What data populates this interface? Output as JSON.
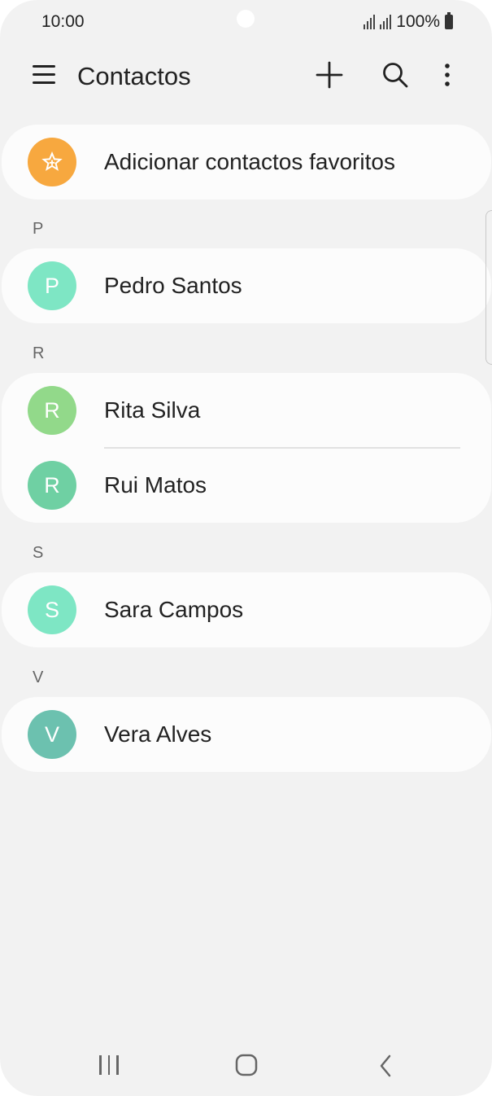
{
  "status_bar": {
    "time": "10:00",
    "battery_text": "100%",
    "icons": [
      "signal-icon",
      "signal-icon",
      "battery-icon"
    ]
  },
  "app_bar": {
    "title": "Contactos",
    "icons": [
      "menu-icon",
      "add-icon",
      "search-icon",
      "more-options-icon"
    ]
  },
  "favorites": {
    "label": "Adicionar contactos favoritos",
    "icon": "star-icon",
    "color": "#F7A83F"
  },
  "sections": [
    {
      "letter": "P",
      "contacts": [
        {
          "initial": "P",
          "name": "Pedro Santos",
          "color": "#7EE6C4"
        }
      ]
    },
    {
      "letter": "R",
      "contacts": [
        {
          "initial": "R",
          "name": "Rita Silva",
          "color": "#92D98A"
        },
        {
          "initial": "R",
          "name": "Rui Matos",
          "color": "#6FD0A3"
        }
      ]
    },
    {
      "letter": "S",
      "contacts": [
        {
          "initial": "S",
          "name": "Sara Campos",
          "color": "#7EE6C4"
        }
      ]
    },
    {
      "letter": "V",
      "contacts": [
        {
          "initial": "V",
          "name": "Vera Alves",
          "color": "#6CC1AF"
        }
      ]
    }
  ],
  "nav_bar": {
    "icons": [
      "recent-apps-icon",
      "home-icon",
      "back-icon"
    ]
  }
}
